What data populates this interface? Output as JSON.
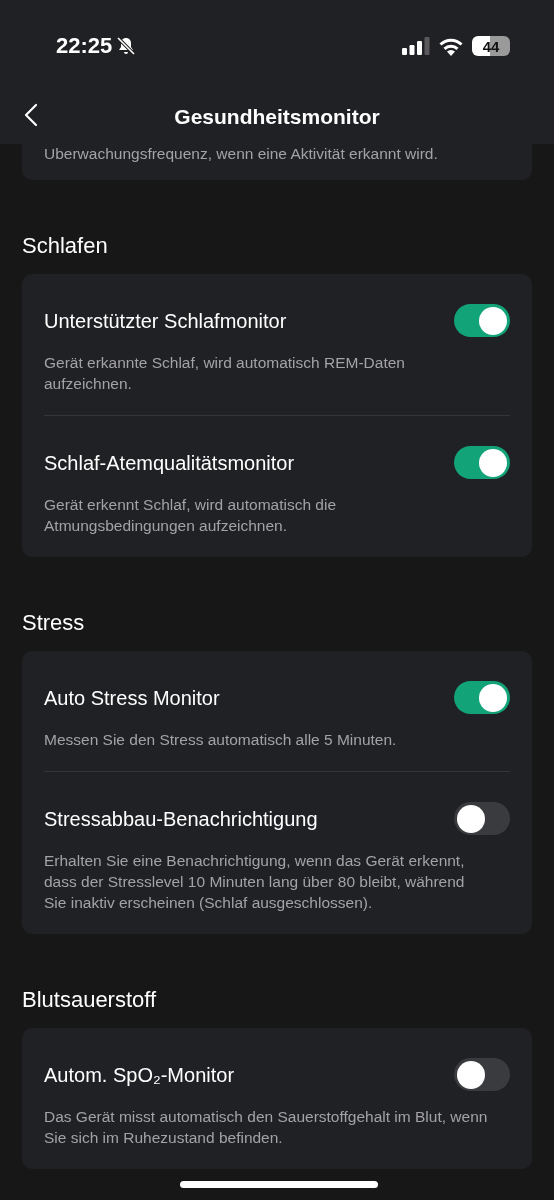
{
  "status_bar": {
    "time": "22:25",
    "battery": "44"
  },
  "header": {
    "title": "Gesundheitsmonitor"
  },
  "partial_card": {
    "description": "Uberwachungsfrequenz, wenn eine Aktivität erkannt wird."
  },
  "sections": [
    {
      "title": "Schlafen",
      "items": [
        {
          "title": "Unterstützter Schlafmonitor",
          "description": "Gerät erkannte Schlaf, wird automatisch REM-Daten aufzeichnen.",
          "on": true
        },
        {
          "title": "Schlaf-Atemqualitätsmonitor",
          "description": "Gerät erkennt Schlaf, wird automatisch die Atmungsbedingungen aufzeichnen.",
          "on": true
        }
      ]
    },
    {
      "title": "Stress",
      "items": [
        {
          "title": "Auto Stress Monitor",
          "description": "Messen Sie den Stress automatisch alle 5 Minuten.",
          "on": true
        },
        {
          "title": "Stressabbau-Benachrichtigung",
          "description": "Erhalten Sie eine Benachrichtigung, wenn das Gerät erkennt, dass der Stresslevel 10 Minuten lang über 80 bleibt, während Sie inaktiv erscheinen (Schlaf ausgeschlossen).",
          "on": false
        }
      ]
    },
    {
      "title": "Blutsauerstoff",
      "items": [
        {
          "title": "Autom. SpO₂-Monitor",
          "description": "Das Gerät misst automatisch den Sauerstoffgehalt im Blut, wenn Sie sich im Ruhezustand befinden.",
          "on": false
        }
      ]
    }
  ]
}
